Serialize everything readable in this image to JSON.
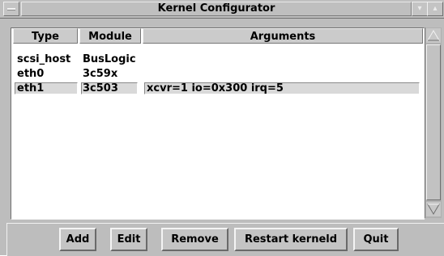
{
  "window": {
    "title": "Kernel Configurator"
  },
  "table": {
    "columns": [
      "Type",
      "Module",
      "Arguments"
    ],
    "rows": [
      {
        "type": "scsi_host",
        "module": "BusLogic",
        "args": ""
      },
      {
        "type": "eth0",
        "module": "3c59x",
        "args": ""
      },
      {
        "type": "eth1",
        "module": "3c503",
        "args": "xcvr=1 io=0x300 irq=5",
        "selected": true
      }
    ]
  },
  "buttons": {
    "add": "Add",
    "edit": "Edit",
    "remove": "Remove",
    "restart": "Restart kerneld",
    "quit": "Quit"
  },
  "icons": {
    "window_menu": "window-menu-icon",
    "minimize": "minimize-icon",
    "maximize": "maximize-icon",
    "scroll_up": "arrow-up-icon",
    "scroll_down": "arrow-down-icon"
  }
}
